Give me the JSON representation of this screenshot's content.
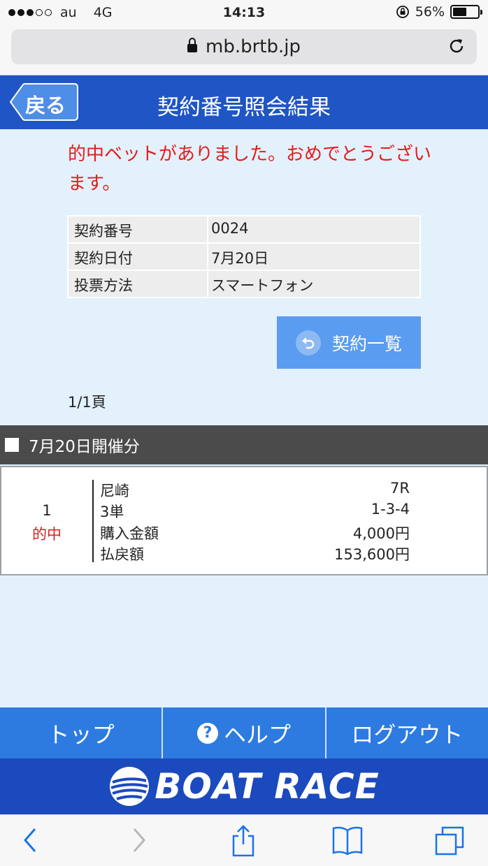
{
  "status_bar": {
    "carrier": "au",
    "network": "4G",
    "time": "14:13",
    "battery": "56%",
    "battery_level": 0.56
  },
  "browser": {
    "url": "mb.brtb.jp"
  },
  "header": {
    "back_label": "戻る",
    "title": "契約番号照会結果"
  },
  "message": "的中ベットがありました。おめでとうございます。",
  "contract_info": [
    {
      "label": "契約番号",
      "value": "0024"
    },
    {
      "label": "契約日付",
      "value": "7月20日"
    },
    {
      "label": "投票方法",
      "value": "スマートフォン"
    }
  ],
  "list_button_label": "契約一覧",
  "page_indicator": "1/1頁",
  "section_title": "7月20日開催分",
  "result": {
    "number": "1",
    "status": "的中",
    "rows": [
      {
        "label": "尼崎",
        "value": "7R"
      },
      {
        "label": "3単",
        "value": "1-3-4"
      },
      {
        "label": "購入金額",
        "value": "4,000円"
      },
      {
        "label": "払戻額",
        "value": "153,600円"
      }
    ]
  },
  "nav": {
    "top": "トップ",
    "help": "ヘルプ",
    "logout": "ログアウト"
  },
  "brand": "BOAT RACE",
  "colors": {
    "header_bg": "#1f55c4",
    "page_bg": "#e3f1fc",
    "accent_red": "#e51b1b",
    "button_blue": "#5a9cf0",
    "nav_blue": "#2d7be0"
  }
}
